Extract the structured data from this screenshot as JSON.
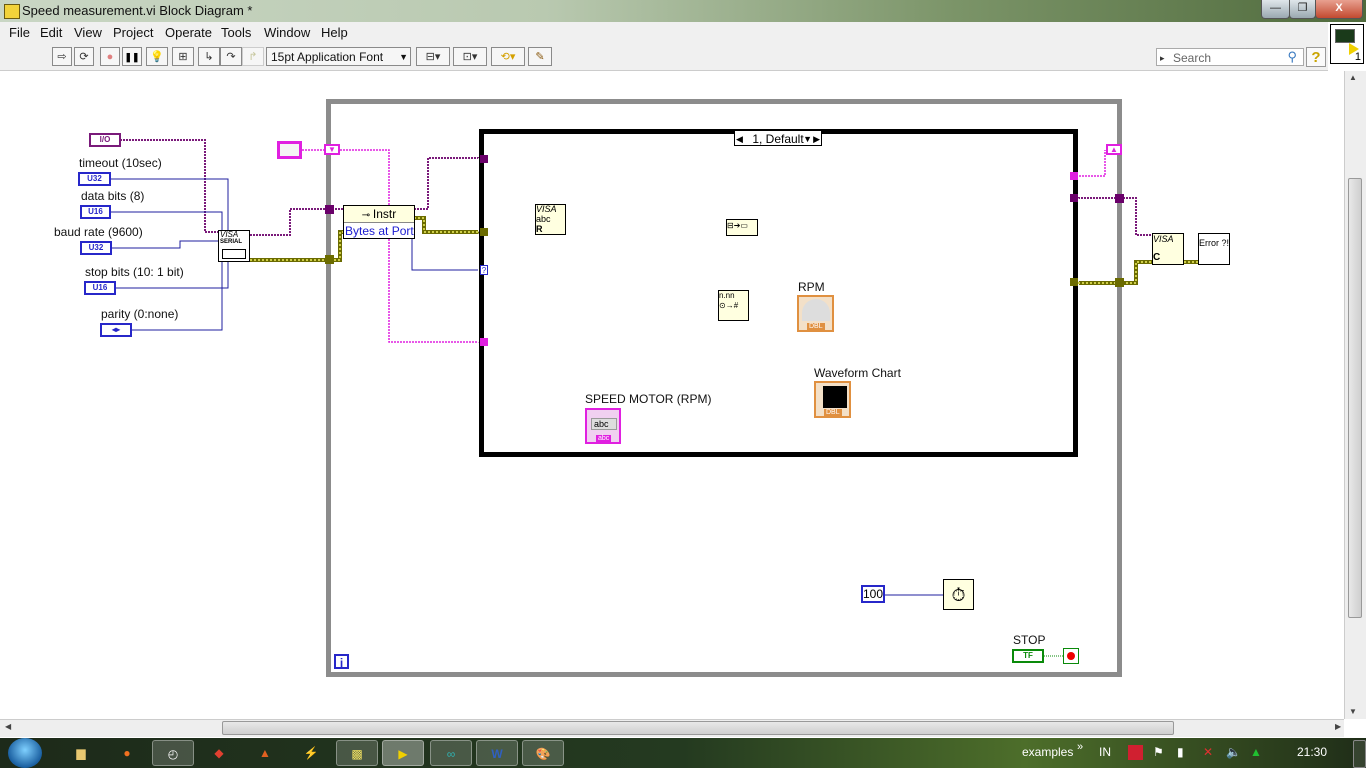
{
  "window": {
    "title": "Speed measurement.vi Block Diagram *",
    "controls": {
      "minimize": "—",
      "restore": "❐",
      "close": "X"
    }
  },
  "menu": [
    "File",
    "Edit",
    "View",
    "Project",
    "Operate",
    "Tools",
    "Window",
    "Help"
  ],
  "toolbar": {
    "run_icon": "⇨",
    "run_continuous_icon": "⟳",
    "abort_icon": "●",
    "pause_icon": "❚❚",
    "highlight_icon": "💡",
    "retain_wire_icon": "⊞",
    "step_into_icon": "↳",
    "step_over_icon": "↷",
    "step_out_icon": "↱",
    "font": "15pt Application Font",
    "align_icon": "⊟▾",
    "distribute_icon": "⊡▾",
    "reorder_icon": "⟲▾",
    "cleanup_icon": "✎",
    "search_placeholder": "Search",
    "help_icon": "?",
    "vi_icon_number": "1"
  },
  "diagram": {
    "inputs": [
      {
        "label": "",
        "type": "I/O"
      },
      {
        "label": "timeout (10sec)",
        "type": "U32"
      },
      {
        "label": "data bits (8)",
        "type": "U16"
      },
      {
        "label": "baud rate (9600)",
        "type": "U32"
      },
      {
        "label": "stop bits (10: 1 bit)",
        "type": "U16"
      },
      {
        "label": "parity (0:none)",
        "type": "◂▸"
      }
    ],
    "visa_serial": {
      "top": "VISA",
      "sub": "SERIAL"
    },
    "property_node": {
      "class": "Instr",
      "property": "Bytes at Port"
    },
    "case_selector": "1, Default",
    "visa_read": {
      "top": "VISA",
      "mid": "abc",
      "bottom": "R"
    },
    "string_to_number": "n.nn",
    "rpm_indicator": {
      "label": "RPM",
      "type": "DBL"
    },
    "waveform_chart": {
      "label": "Waveform Chart",
      "type": "DBL"
    },
    "speed_indicator": {
      "label": "SPEED MOTOR (RPM)",
      "value": "abc",
      "type": "abc"
    },
    "visa_close": {
      "top": "VISA",
      "bottom": "C"
    },
    "error_handler": "Error ?!",
    "wait_constant": "100",
    "stop_control": {
      "label": "STOP",
      "type": "TF"
    },
    "loop_iteration": "i",
    "conditional_terminal": "stop-if-true"
  },
  "taskbar": {
    "apps": [
      "explorer",
      "firefox",
      "labview-timer",
      "book",
      "matlab",
      "tool",
      "sticky-notes",
      "labview",
      "arduino",
      "word",
      "paint"
    ],
    "tray": {
      "toolbar_label": "examples",
      "chevron": "»",
      "language": "IN",
      "time": "21:30"
    }
  }
}
